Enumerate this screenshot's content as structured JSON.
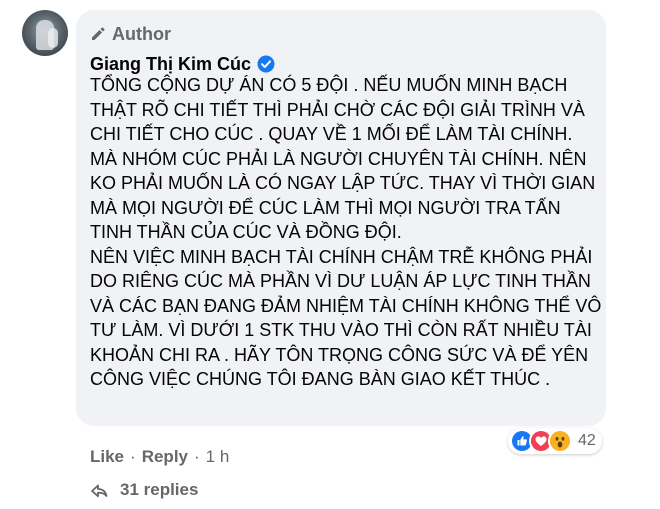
{
  "comment": {
    "author_badge": "Author",
    "author_name": "Giang Thị Kim Cúc",
    "paragraphs": [
      "TỔNG CỘNG DỰ ÁN CÓ 5 ĐỘI . NẾU MUỐN MINH BẠCH THẬT RÕ CHI TIẾT THÌ PHẢI CHỜ CÁC ĐỘI GIẢI TRÌNH VÀ CHI TIẾT CHO CÚC . QUAY VỀ 1 MỐI ĐỂ LÀM TÀI CHÍNH. MÀ NHÓM CÚC PHẢI LÀ NGƯỜI CHUYÊN TÀI CHÍNH. NÊN KO PHẢI MUỐN LÀ CÓ NGAY LẬP TỨC. THAY VÌ THỜI GIAN MÀ MỌI NGƯỜI ĐỂ CÚC LÀM THÌ MỌI NGƯỜI TRA TẤN TINH THẦN CỦA CÚC VÀ ĐỒNG ĐỘI.",
      "NÊN VIỆC MINH BẠCH TÀI CHÍNH CHẬM TRỄ KHÔNG PHẢI DO RIÊNG CÚC MÀ PHẦN VÌ DƯ LUẬN ÁP LỰC TINH THẦN VÀ CÁC BẠN ĐANG ĐẢM NHIỆM TÀI CHÍNH KHÔNG THỂ VÔ TƯ LÀM. VÌ DƯỚI 1 STK THU VÀO THÌ CÒN RẤT NHIỀU TÀI KHOẢN CHI RA . HÃY TÔN TRỌNG CÔNG SỨC VÀ ĐỂ YÊN CÔNG VIỆC CHÚNG TÔI ĐANG BÀN GIAO KẾT THÚC ."
    ],
    "reactions": {
      "icons": [
        "like-icon",
        "love-icon",
        "wow-icon"
      ],
      "count": "42"
    },
    "actions": {
      "like": "Like",
      "reply": "Reply",
      "separator": "·",
      "time": "1 h"
    },
    "replies_label": "31 replies"
  },
  "colors": {
    "bubble": "#f0f2f5",
    "secondary_text": "#65676b",
    "verified": "#1877f2"
  }
}
